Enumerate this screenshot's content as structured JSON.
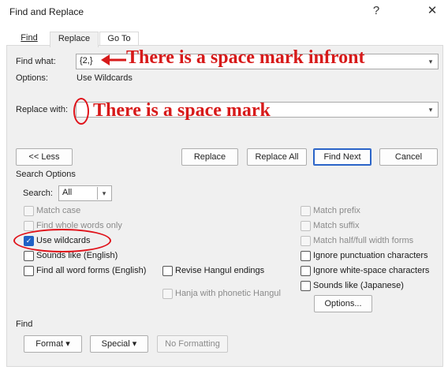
{
  "window": {
    "title": "Find and Replace",
    "help_icon": "?",
    "close_icon": "✕"
  },
  "tabs": [
    {
      "label": "Find",
      "key": "d"
    },
    {
      "label": "Replace",
      "key": "p"
    },
    {
      "label": "Go To",
      "key": "G"
    }
  ],
  "find": {
    "label": "Find what:",
    "value": "{2,}",
    "options_label": "Options:",
    "options_value": "Use Wildcards"
  },
  "replace": {
    "label": "Replace with:",
    "value": ""
  },
  "buttons": {
    "less": "<< Less",
    "replace": "Replace",
    "replace_all": "Replace All",
    "find_next": "Find Next",
    "cancel": "Cancel",
    "options": "Options...",
    "format": "Format",
    "special": "Special",
    "no_formatting": "No Formatting"
  },
  "search_options": {
    "heading": "Search Options",
    "search_label": "Search:",
    "search_value": "All"
  },
  "checkboxes_left": [
    {
      "label": "Match case",
      "checked": false,
      "disabled": true
    },
    {
      "label": "Find whole words only",
      "checked": false,
      "disabled": true
    },
    {
      "label": "Use wildcards",
      "checked": true,
      "disabled": false
    },
    {
      "label": "Sounds like (English)",
      "checked": false,
      "disabled": false
    },
    {
      "label": "Find all word forms (English)",
      "checked": false,
      "disabled": false
    }
  ],
  "checkboxes_middle": [
    {
      "label": "Revise Hangul endings",
      "checked": false,
      "disabled": false
    },
    {
      "label": "Hanja with phonetic Hangul",
      "checked": false,
      "disabled": true
    }
  ],
  "checkboxes_right": [
    {
      "label": "Match prefix",
      "checked": false,
      "disabled": true
    },
    {
      "label": "Match suffix",
      "checked": false,
      "disabled": true
    },
    {
      "label": "Match half/full width forms",
      "checked": false,
      "disabled": true
    },
    {
      "label": "Ignore punctuation characters",
      "checked": false,
      "disabled": false
    },
    {
      "label": "Ignore white-space characters",
      "checked": false,
      "disabled": false
    },
    {
      "label": "Sounds like (Japanese)",
      "checked": false,
      "disabled": false
    }
  ],
  "find_section": {
    "heading": "Find"
  },
  "annotations": {
    "find_note": "There is a space mark infront",
    "replace_note": "There is a space mark",
    "color": "#d71a1a"
  }
}
